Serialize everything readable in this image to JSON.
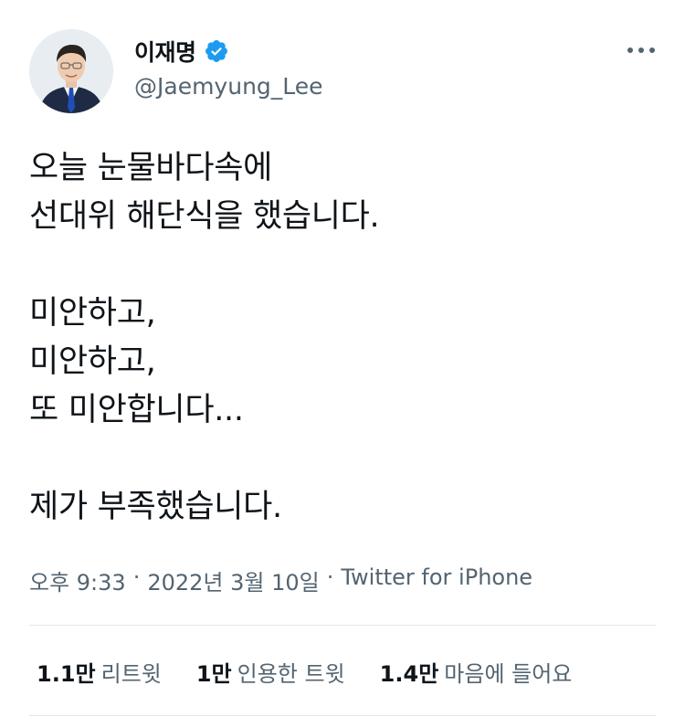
{
  "author": {
    "display_name": "이재명",
    "handle": "@Jaemyung_Lee",
    "verified": true,
    "verified_color": "#1d9bf0"
  },
  "tweet": {
    "paragraphs": [
      "오늘 눈물바다속에\n선대위 해단식을 했습니다.",
      "미안하고,\n미안하고,\n또 미안합니다...",
      "제가 부족했습니다."
    ],
    "time": "오후 9:33",
    "date": "2022년 3월 10일",
    "separator": "·",
    "source": "Twitter for iPhone"
  },
  "stats": {
    "retweets_count": "1.1만",
    "retweets_label": "리트윗",
    "quotes_count": "1만",
    "quotes_label": "인용한 트윗",
    "likes_count": "1.4만",
    "likes_label": "마음에 들어요"
  },
  "colors": {
    "text": "#0f1419",
    "secondary": "#536471",
    "divider": "#e3e7ea"
  }
}
